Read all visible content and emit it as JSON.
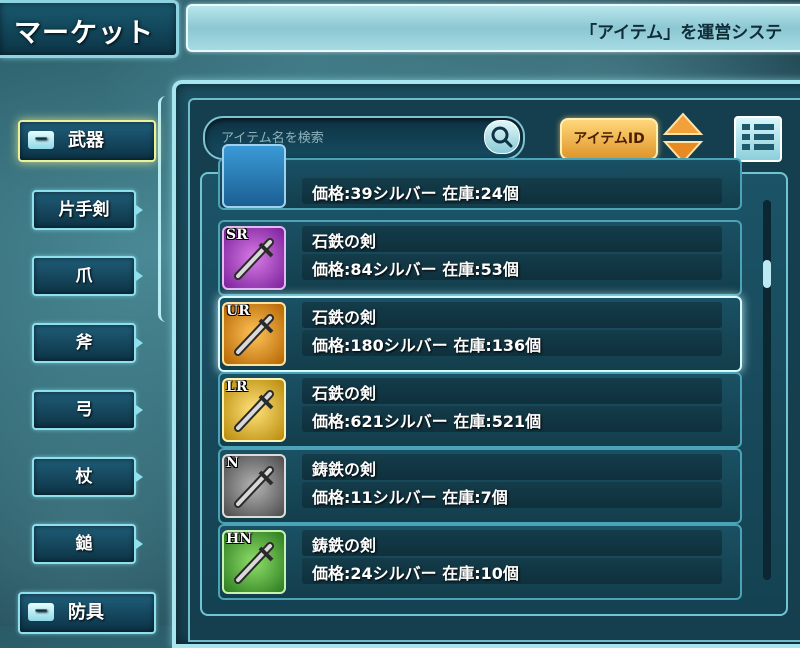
{
  "header": {
    "title": "マーケット",
    "info": "「アイテム」を運営システ"
  },
  "categories": {
    "main": {
      "label": "武器",
      "badge": "−"
    },
    "sub": [
      {
        "label": "片手剣"
      },
      {
        "label": "爪"
      },
      {
        "label": "斧"
      },
      {
        "label": "弓"
      },
      {
        "label": "杖"
      },
      {
        "label": "鎚"
      }
    ],
    "armor": {
      "label": "防具",
      "badge": "−"
    }
  },
  "search": {
    "placeholder": "アイテム名を検索",
    "icon": "search-icon"
  },
  "sort": {
    "label": "アイテムID",
    "icon": "sort-updown-icon"
  },
  "view_toggle": {
    "icon": "grid-view-icon"
  },
  "items": [
    {
      "rarity": "",
      "name": "",
      "info": "価格:39シルバー 在庫:24個",
      "color": "#2a7fbf"
    },
    {
      "rarity": "SR",
      "name": "石鉄の剣",
      "info": "価格:84シルバー 在庫:53個",
      "color": "#9b2fb6"
    },
    {
      "rarity": "UR",
      "name": "石鉄の剣",
      "info": "価格:180シルバー 在庫:136個",
      "color": "#d98a14"
    },
    {
      "rarity": "LR",
      "name": "石鉄の剣",
      "info": "価格:621シルバー 在庫:521個",
      "color": "#d8b21f"
    },
    {
      "rarity": "N",
      "name": "鋳鉄の剣",
      "info": "価格:11シルバー 在庫:7個",
      "color": "#777777"
    },
    {
      "rarity": "HN",
      "name": "鋳鉄の剣",
      "info": "価格:24シルバー 在庫:10個",
      "color": "#3fa23a"
    }
  ]
}
